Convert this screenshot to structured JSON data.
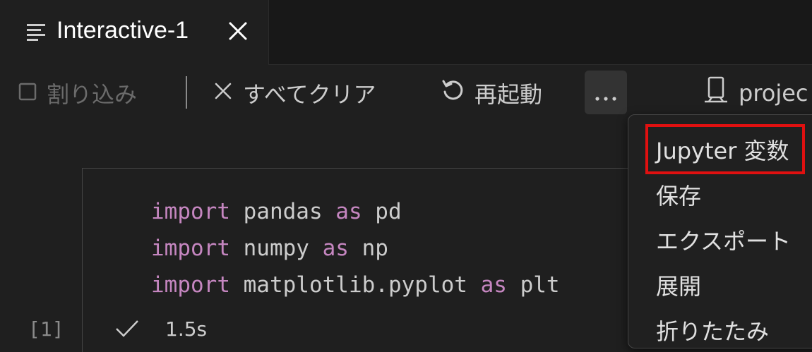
{
  "tab": {
    "title": "Interactive-1"
  },
  "toolbar": {
    "interrupt_label": "割り込み",
    "clear_all_label": "すべてクリア",
    "restart_label": "再起動",
    "kernel_label": "projec"
  },
  "cell": {
    "execution_count": "[1]",
    "duration": "1.5s",
    "lines": [
      {
        "kw1": "import",
        "mod": " pandas ",
        "kw2": "as",
        "alias": " pd"
      },
      {
        "kw1": "import",
        "mod": " numpy ",
        "kw2": "as",
        "alias": " np"
      },
      {
        "kw1": "import",
        "mod": " matplotlib.pyplot ",
        "kw2": "as",
        "alias": " plt"
      }
    ]
  },
  "menu": {
    "items": [
      "Jupyter 変数",
      "保存",
      "エクスポート",
      "展開",
      "折りたたみ"
    ],
    "highlighted_item": "Jupyter 変数"
  },
  "colors": {
    "keyword": "#c586c0",
    "highlight_border": "#e01010",
    "background": "#1f1f1f"
  },
  "icons": [
    "list-icon",
    "close-icon",
    "stop-square-icon",
    "clear-x-icon",
    "restart-icon",
    "more-ellipsis-icon",
    "kernel-server-icon",
    "check-icon"
  ]
}
